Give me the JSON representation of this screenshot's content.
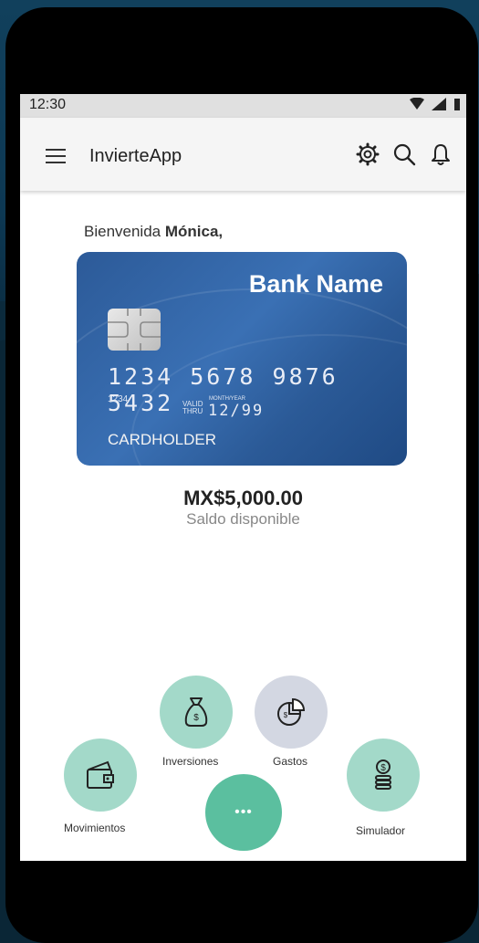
{
  "status_bar": {
    "time": "12:30",
    "icons": [
      "wifi-icon",
      "signal-icon",
      "battery-icon"
    ]
  },
  "appbar": {
    "title": "InvierteApp",
    "icons": [
      "menu-icon",
      "settings-icon",
      "search-icon",
      "bell-icon"
    ]
  },
  "greeting": {
    "prefix": "Bienvenida ",
    "name": "Mónica,"
  },
  "card": {
    "bank_name": "Bank Name",
    "number": "1234 5678 9876 5432",
    "short_number": "1234",
    "valid_label_1": "VALID",
    "valid_label_2": "THRU",
    "month_year_label": "MONTH/YEAR",
    "expiry": "12/99",
    "holder": "CARDHOLDER"
  },
  "balance": {
    "amount": "MX$5,000.00",
    "label": "Saldo disponible"
  },
  "actions": {
    "movimientos": "Movimientos",
    "inversiones": "Inversiones",
    "gastos": "Gastos",
    "simulador": "Simulador",
    "more": "•••"
  },
  "colors": {
    "accent": "#5bbf9f",
    "mint": "#a3d9c9",
    "grey": "#d3d7e2",
    "card": "#2c5a98"
  }
}
